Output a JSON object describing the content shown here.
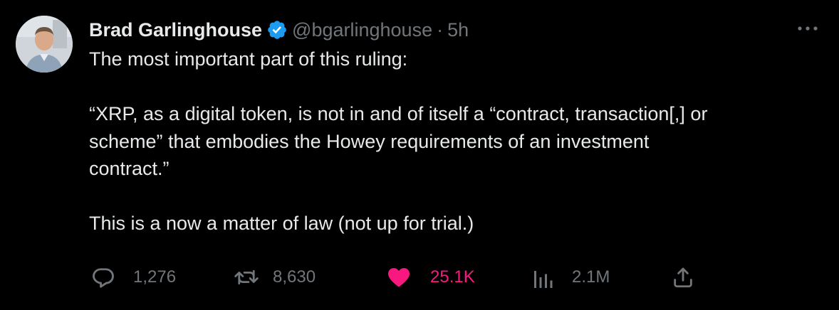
{
  "author": {
    "name": "Brad Garlinghouse",
    "handle": "@bgarlinghouse",
    "separator": "·",
    "time": "5h",
    "verified": true,
    "verified_color": "#1d9bf0"
  },
  "tweet": {
    "paragraphs": [
      "The most important part of this ruling:",
      "“XRP, as a digital token, is not in and of itself a “contract, transaction[,] or",
      "scheme” that embodies the Howey requirements of an investment",
      "contract.”",
      "This is a now a matter of law (not up for trial.)"
    ]
  },
  "actions": {
    "reply": {
      "icon": "reply-icon",
      "count": "1,276"
    },
    "retweet": {
      "icon": "retweet-icon",
      "count": "8,630"
    },
    "like": {
      "icon": "heart-icon",
      "count": "25.1K",
      "active": true,
      "color": "#f91880"
    },
    "views": {
      "icon": "views-icon",
      "count": "2.1M"
    },
    "share": {
      "icon": "share-icon"
    }
  },
  "menu": {
    "icon": "more-icon"
  },
  "colors": {
    "background": "#000000",
    "text": "#e7e9ea",
    "muted": "#71767b",
    "like": "#f91880",
    "verified": "#1d9bf0"
  }
}
